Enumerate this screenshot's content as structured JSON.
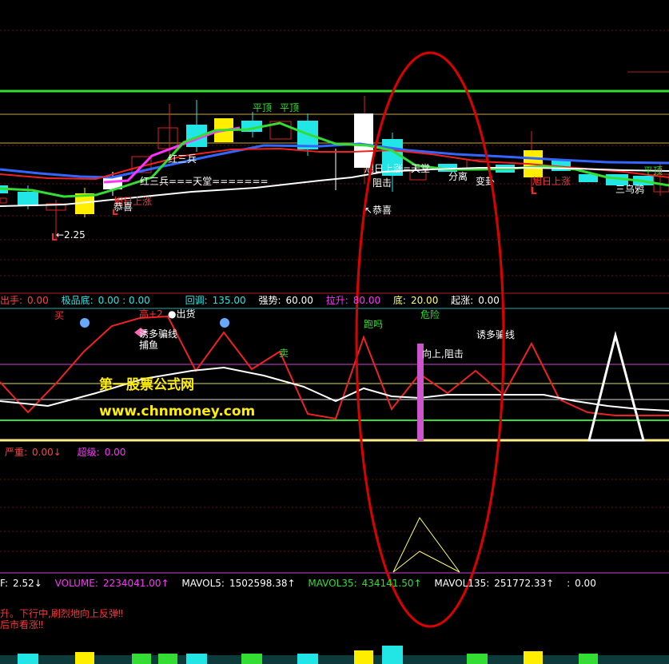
{
  "colors": {
    "background": "#000000",
    "up": "#ffee00",
    "down": "#22e6e6",
    "green_line": "#33dd33",
    "magenta_line": "#ff33ff",
    "red_line": "#ee2222",
    "blue_line": "#3366ff",
    "white_line": "#ffffff",
    "annotation_circle": "#dd0000"
  },
  "main_chart": {
    "signals": {
      "ping_ding_1": "平顶",
      "ping_ding_2": "平顶",
      "hong_san_bing": "红三兵",
      "hong_san_bing_tiantang": "红三兵===天堂=======",
      "xu_ri_shang_zhang_left": "旭日上涨",
      "gong_xi_left": "恭喜",
      "low_price": "←2.25",
      "xu_ri_tiantang": "旭日上涨=天堂",
      "zu_ji": "阻击",
      "gong_xi": "↖恭喜",
      "fen_li": "分离",
      "bian_gua": "变卦",
      "xu_ri_shang_zhang_right": "旭日上涨",
      "san_wu_ya": "三乌鸦",
      "ping_ding_right": "平顶"
    }
  },
  "indicator1": {
    "header": [
      {
        "label": "出手:",
        "value": "0.00",
        "color": "#ff4444"
      },
      {
        "label": "极品底:",
        "value": "0.00 : 0.00",
        "color": "#22e6e6"
      },
      {
        "label": "回调:",
        "value": "135.00",
        "color": "#22e6e6"
      },
      {
        "label": "强势:",
        "value": "60.00",
        "color": "#ffffff"
      },
      {
        "label": "拉升:",
        "value": "80.00",
        "color": "#ff33ff"
      },
      {
        "label": "底:",
        "value": "20.00",
        "color": "#ffff66"
      },
      {
        "label": "起涨:",
        "value": "0.00",
        "color": "#ffffff"
      }
    ],
    "signals": {
      "mai": "买",
      "gao": "高+2",
      "chu_huo": "●出货",
      "you_duo_pian_xian": "诱多骗线",
      "bu_yu": "捕鱼",
      "mai_sell": "卖",
      "pao_ma": "跑吗",
      "wei_xian": "危险",
      "you_duo_pian_xian_2": "诱多骗线",
      "xiang_shang_zu_ji": "向上,阻击"
    },
    "watermark_title": "第一股票公式网",
    "watermark_url": "www.chnmoney.com"
  },
  "indicator2": {
    "header": [
      {
        "label": "严重:",
        "value": "0.00↓",
        "color": "#ff4444"
      },
      {
        "label": "超级:",
        "value": "0.00",
        "color": "#ff33ff"
      }
    ]
  },
  "volume": {
    "header": [
      {
        "label": "F:",
        "value": "2.52↓",
        "color": "#ffffff"
      },
      {
        "label": "VOLUME:",
        "value": "2234041.00↑",
        "color": "#ff33ff"
      },
      {
        "label": "MAVOL5:",
        "value": "1502598.38↑",
        "color": "#ffffff"
      },
      {
        "label": "MAVOL35:",
        "value": "434141.50↑",
        "color": "#33dd33"
      },
      {
        "label": "MAVOL135:",
        "value": "251772.33↑",
        "color": "#ffffff"
      },
      {
        "label": ":",
        "value": "0.00",
        "color": "#ffffff"
      }
    ],
    "note_line1": "升。下行中,刷烈地向上反弹‼",
    "note_line2": "后市看涨‼"
  }
}
